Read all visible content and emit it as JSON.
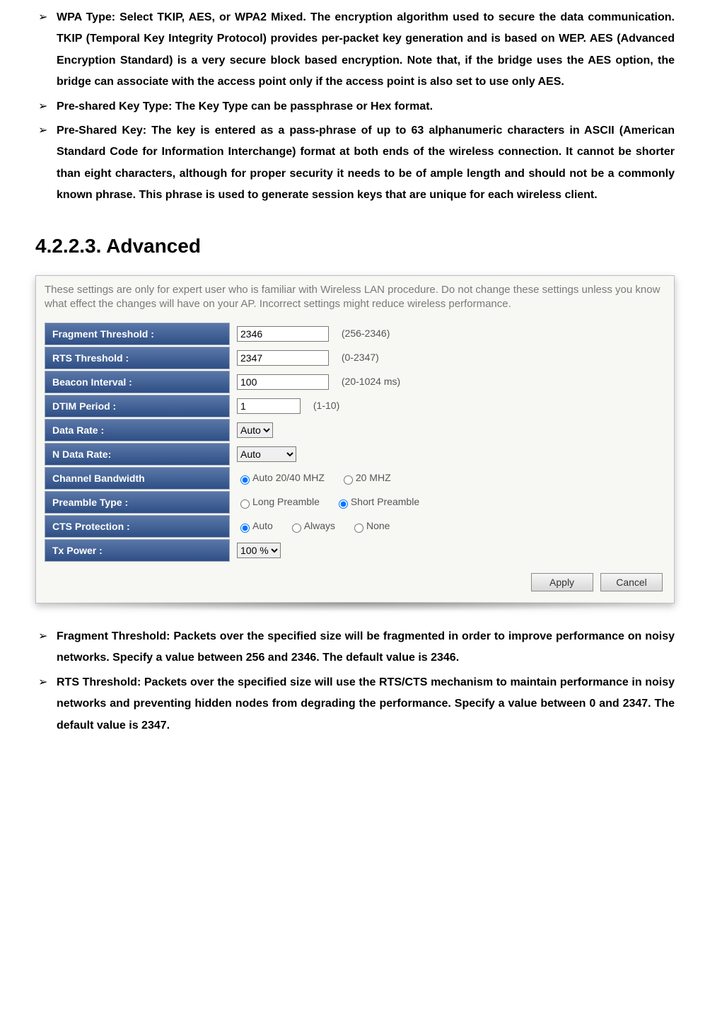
{
  "top_bullets": [
    "WPA Type: Select TKIP, AES, or WPA2 Mixed. The encryption algorithm used to secure the data communication. TKIP (Temporal Key Integrity Protocol) provides per-packet key generation and is based on WEP. AES (Advanced Encryption Standard) is a very secure block based encryption. Note that, if the bridge uses the AES option, the bridge can associate with the access point only if the access point is also set to use only AES.",
    "Pre-shared Key Type: The Key Type can be passphrase or Hex format.",
    "Pre-Shared Key: The key is entered as a pass-phrase of up to 63 alphanumeric characters in ASCII (American Standard Code for Information Interchange) format at both ends of the wireless connection. It cannot be shorter than eight characters, although for proper security it needs to be of ample length and should not be a commonly known phrase. This phrase is used to generate session keys that are unique for each wireless client."
  ],
  "section_heading": "4.2.2.3.  Advanced",
  "panel": {
    "intro": "These settings are only for expert user who is familiar with Wireless LAN procedure. Do not change these settings unless you know what effect the changes will have on your AP. Incorrect settings might reduce wireless performance.",
    "fragment": {
      "label": "Fragment Threshold :",
      "value": "2346",
      "hint": "(256-2346)"
    },
    "rts": {
      "label": "RTS Threshold :",
      "value": "2347",
      "hint": "(0-2347)"
    },
    "beacon": {
      "label": "Beacon Interval :",
      "value": "100",
      "hint": "(20-1024 ms)"
    },
    "dtim": {
      "label": "DTIM Period :",
      "value": "1",
      "hint": "(1-10)"
    },
    "datarate": {
      "label": "Data Rate :",
      "value": "Auto"
    },
    "ndatarate": {
      "label": "N Data Rate:",
      "value": "Auto"
    },
    "chbw": {
      "label": "Channel Bandwidth",
      "opt1": "Auto 20/40 MHZ",
      "opt2": "20 MHZ"
    },
    "preamble": {
      "label": "Preamble Type :",
      "opt1": "Long Preamble",
      "opt2": "Short Preamble"
    },
    "cts": {
      "label": "CTS Protection :",
      "opt1": "Auto",
      "opt2": "Always",
      "opt3": "None"
    },
    "txpower": {
      "label": "Tx Power :",
      "value": "100 %"
    },
    "apply": "Apply",
    "cancel": "Cancel"
  },
  "bottom_bullets": [
    "Fragment Threshold: Packets over the specified size will be fragmented in order to improve performance on noisy networks. Specify a value between 256 and 2346. The default value is 2346.",
    "RTS Threshold: Packets over the specified size will use the RTS/CTS mechanism to maintain performance in noisy networks and preventing hidden nodes from degrading the performance. Specify a value between 0 and 2347. The default value is 2347."
  ]
}
